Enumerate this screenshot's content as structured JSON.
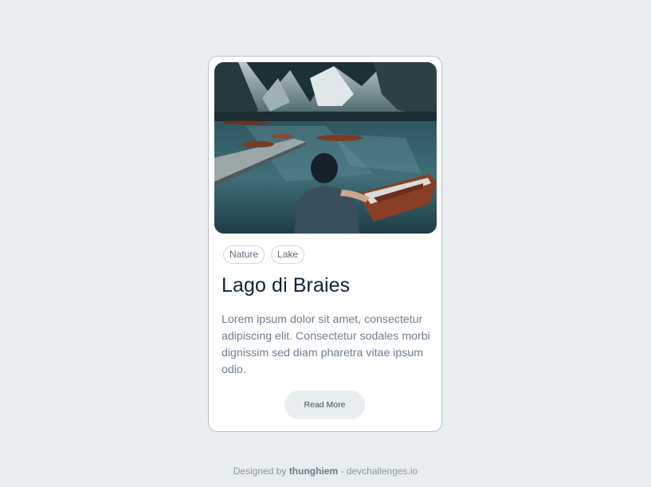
{
  "card": {
    "image_alt": "Man sitting on a dock beside rowing boats on a mountain lake",
    "tags": [
      "Nature",
      "Lake"
    ],
    "title": "Lago di Braies",
    "description": "Lorem ipsum dolor sit amet, consectetur adipiscing elit. Consectetur sodales morbi dignissim sed diam pharetra vitae ipsum odio.",
    "button_label": "Read More"
  },
  "footer": {
    "prefix": "Designed by",
    "author": "thunghiem",
    "separator": "-",
    "site": "devchallenges.io"
  }
}
